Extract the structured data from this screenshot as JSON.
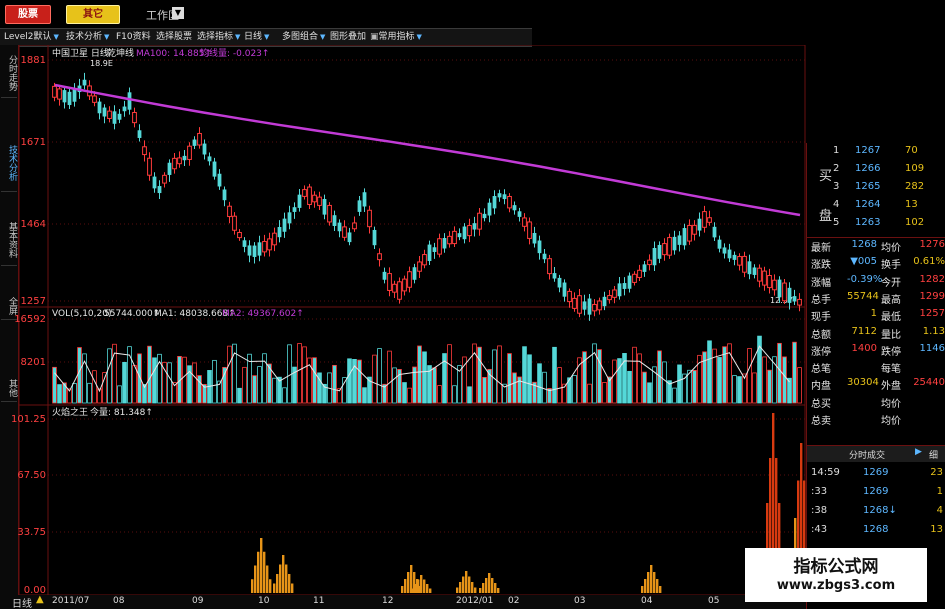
{
  "header": {
    "stocks_label": "股票",
    "other_label": "其它",
    "workspace_label": "工作区"
  },
  "toolbar": {
    "items": [
      "Level2默认",
      "技术分析",
      "F10资料",
      "选择股票",
      "选择指标",
      "日线",
      "多图组合",
      "图形叠加",
      "常用指标"
    ]
  },
  "side_tabs": [
    "分时走势",
    "技术分析",
    "基本资料",
    "全屏",
    "其他"
  ],
  "price_chart": {
    "title": "中国卫星 日线",
    "indicator": "乾坤线",
    "ma_label": "MA100: 14.885↑",
    "avg_label": "均线量: -0.023↑",
    "annotation_top": "18.9E",
    "annotation_bottom": "12.57",
    "y_ticks": [
      "1881",
      "1671",
      "1464",
      "1257"
    ]
  },
  "volume_chart": {
    "legend": "VOL(5,10,20)",
    "vol": "55744.000↑",
    "ma1": "MA1: 48038.668↑",
    "ma2": "MA2: 49367.602↑",
    "y_ticks": [
      "16592",
      "8201"
    ]
  },
  "indicator_chart": {
    "name": "火焰之王",
    "value": "今量: 81.348↑",
    "y_ticks": [
      "101.25",
      "67.50",
      "33.75",
      "0.00"
    ]
  },
  "x_axis": {
    "labels": [
      "2011/07",
      "08",
      "09",
      "10",
      "11",
      "12",
      "2012/01",
      "02",
      "03",
      "04",
      "05"
    ],
    "period_label": "日线"
  },
  "order_book": {
    "buy_label": "买",
    "sell_label": "盘",
    "rows": [
      {
        "n": "1",
        "price": "1267",
        "vol": "70"
      },
      {
        "n": "2",
        "price": "1266",
        "vol": "109"
      },
      {
        "n": "3",
        "price": "1265",
        "vol": "282"
      },
      {
        "n": "4",
        "price": "1264",
        "vol": "13"
      },
      {
        "n": "5",
        "price": "1263",
        "vol": "102"
      }
    ]
  },
  "quote": [
    {
      "l1": "最新",
      "v1": "1268",
      "l2": "均价",
      "v2": "1276"
    },
    {
      "l1": "涨跌",
      "v1": "▼005",
      "l2": "换手",
      "v2": "0.61%"
    },
    {
      "l1": "涨幅",
      "v1": "-0.39%",
      "l2": "今开",
      "v2": "1282"
    },
    {
      "l1": "总手",
      "v1": "55744",
      "l2": "最高",
      "v2": "1299"
    },
    {
      "l1": "现手",
      "v1": "1",
      "l2": "最低",
      "v2": "1257"
    },
    {
      "l1": "总额",
      "v1": "7112",
      "l2": "量比",
      "v2": "1.13"
    },
    {
      "l1": "涨停",
      "v1": "1400",
      "l2": "跌停",
      "v2": "1146"
    },
    {
      "l1": "总笔",
      "v1": "",
      "l2": "每笔",
      "v2": ""
    },
    {
      "l1": "内盘",
      "v1": "30304",
      "l2": "外盘",
      "v2": "25440"
    },
    {
      "l1": "总买",
      "v1": "",
      "l2": "均价",
      "v2": ""
    },
    {
      "l1": "总卖",
      "v1": "",
      "l2": "均价",
      "v2": ""
    }
  ],
  "ticks": {
    "header": "分时成交",
    "tab": "细",
    "rows": [
      {
        "time": "14:59",
        "price": "1269",
        "vol": "23"
      },
      {
        "time": ":33",
        "price": "1269",
        "vol": "1"
      },
      {
        "time": ":38",
        "price": "1268↓",
        "vol": "4"
      },
      {
        "time": ":43",
        "price": "1268",
        "vol": "13"
      }
    ]
  },
  "watermark": {
    "title": "指标公式网",
    "url": "www.zbgs3.com"
  },
  "colors": {
    "up": "#ff3b3b",
    "down": "#54d8d8",
    "ma_line": "#c23bd6",
    "bg": "#000000",
    "grid": "#5a0e0e"
  }
}
